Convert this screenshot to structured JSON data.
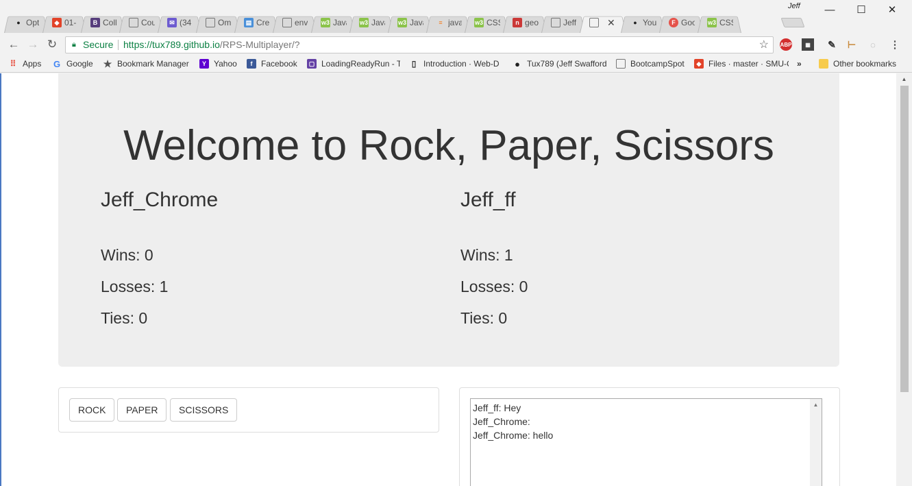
{
  "browser": {
    "profile_name": "Jeff",
    "tabs": [
      {
        "title": "Opt",
        "icon": "github-icon"
      },
      {
        "title": "01-",
        "icon": "gitlab-icon"
      },
      {
        "title": "Coll",
        "icon": "bootstrap-icon"
      },
      {
        "title": "Cou",
        "icon": "page-icon"
      },
      {
        "title": "(34",
        "icon": "mail-icon"
      },
      {
        "title": "Om",
        "icon": "page-icon"
      },
      {
        "title": "Cre",
        "icon": "calendar-icon"
      },
      {
        "title": "env",
        "icon": "page-icon"
      },
      {
        "title": "Java",
        "icon": "w3schools-icon"
      },
      {
        "title": "Java",
        "icon": "w3schools-icon"
      },
      {
        "title": "Java",
        "icon": "w3schools-icon"
      },
      {
        "title": "java",
        "icon": "stackoverflow-icon"
      },
      {
        "title": "CSS",
        "icon": "w3schools-icon"
      },
      {
        "title": "geo",
        "icon": "npm-icon"
      },
      {
        "title": "Jeff",
        "icon": "page-icon"
      },
      {
        "title": "",
        "icon": "page-icon",
        "active": true
      },
      {
        "title": "You",
        "icon": "github-icon"
      },
      {
        "title": "Goo",
        "icon": "firebase-icon"
      },
      {
        "title": "CSS",
        "icon": "w3schools-icon"
      }
    ],
    "address": {
      "security_label": "Secure",
      "url_host": "https://tux789.github.io",
      "url_path": "/RPS-Multiplayer/?"
    },
    "extensions": [
      "ABP"
    ],
    "bookmarks": [
      {
        "label": "Apps",
        "icon": "apps-icon"
      },
      {
        "label": "Google",
        "icon": "google-icon"
      },
      {
        "label": "Bookmark Manager",
        "icon": "star-icon"
      },
      {
        "label": "Yahoo",
        "icon": "yahoo-icon"
      },
      {
        "label": "Facebook",
        "icon": "facebook-icon"
      },
      {
        "label": "LoadingReadyRun - T",
        "icon": "twitch-icon"
      },
      {
        "label": "Introduction · Web-D",
        "icon": "book-icon"
      },
      {
        "label": "Tux789 (Jeff Swafford",
        "icon": "github-icon"
      },
      {
        "label": "BootcampSpot",
        "icon": "page-icon"
      },
      {
        "label": "Files · master · SMU-C",
        "icon": "gitlab-icon"
      }
    ],
    "bookmarks_overflow": "»",
    "other_bookmarks": "Other bookmarks"
  },
  "page": {
    "title": "Welcome to Rock, Paper, Scissors",
    "player1": {
      "name": "Jeff_Chrome",
      "wins": "Wins: 0",
      "losses": "Losses: 1",
      "ties": "Ties: 0"
    },
    "player2": {
      "name": "Jeff_ff",
      "wins": "Wins: 1",
      "losses": "Losses: 0",
      "ties": "Ties: 0"
    },
    "buttons": {
      "rock": "ROCK",
      "paper": "PAPER",
      "scissors": "SCISSORS"
    },
    "chat": [
      "Jeff_ff: Hey",
      "Jeff_Chrome:",
      "Jeff_Chrome: hello"
    ]
  }
}
